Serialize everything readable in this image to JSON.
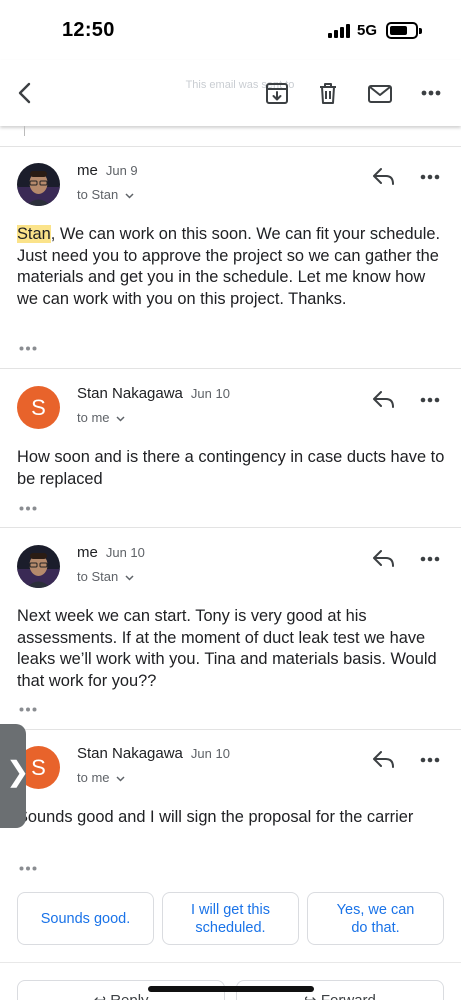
{
  "status_bar": {
    "time": "12:50",
    "network": "5G"
  },
  "toolbar": {
    "ghost_text": "This email was sent to",
    "icons": [
      "back-icon",
      "archive-icon",
      "trash-icon",
      "mail-icon",
      "more-icon"
    ]
  },
  "messages": [
    {
      "sender": "me",
      "date": "Jun 9",
      "recipient": "to Stan",
      "highlight": "Stan",
      "body": ", We can work on this soon. We can fit your schedule. Just need you to approve the project so we can gather the materials and get you in the schedule. Let me know how we can work with you on this project. Thanks."
    },
    {
      "sender": "Stan Nakagawa",
      "avatar_letter": "S",
      "date": "Jun 10",
      "recipient": "to me",
      "body": "How soon and is there a contingency in case ducts have to be replaced"
    },
    {
      "sender": "me",
      "date": "Jun 10",
      "recipient": "to Stan",
      "body": "Next week we can start. Tony is very good at his assessments. If at the moment of duct leak test we have leaks we’ll work with you. Tina and materials basis. Would that work for you??"
    },
    {
      "sender": "Stan Nakagawa",
      "avatar_letter": "S",
      "date": "Jun 10",
      "recipient": "to me",
      "body": "Sounds good and I will sign the proposal for the carrier"
    }
  ],
  "side_handle": {
    "glyph": "❯"
  },
  "smart_replies": [
    "Sounds good.",
    "I will get this scheduled.",
    "Yes, we can do that."
  ],
  "actions": {
    "reply": "Reply",
    "forward": "Forward"
  },
  "colors": {
    "accent": "#1a73e8",
    "avatar": "#e8632b",
    "highlight": "#fbe38a"
  }
}
